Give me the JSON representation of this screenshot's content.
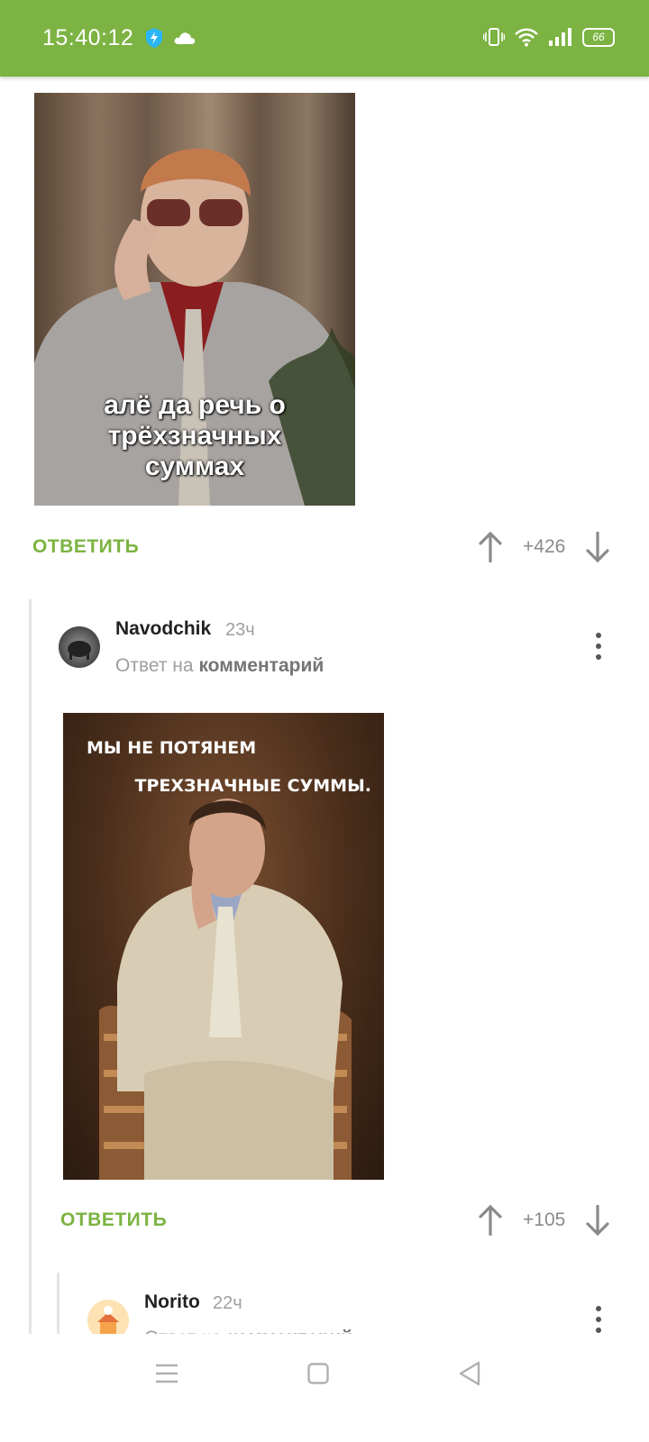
{
  "status_bar": {
    "time": "15:40:12",
    "battery": "66",
    "colors": {
      "background": "#7cb342"
    }
  },
  "comments": [
    {
      "image_caption": "алё да речь о трёхзначных суммах",
      "reply_label": "ОТВЕТИТЬ",
      "score": "+426"
    },
    {
      "username": "Navodchik",
      "time": "23ч",
      "reply_prefix": "Ответ на",
      "reply_target": "комментарий",
      "image_caption_line1": "МЫ НЕ ПОТЯНЕМ",
      "image_caption_line2": "ТРЕХЗНАЧНЫЕ СУММЫ.",
      "reply_label": "ОТВЕТИТЬ",
      "score": "+105"
    },
    {
      "username": "Norito",
      "time": "22ч",
      "reply_prefix": "Ответ на",
      "reply_target": "комментарий"
    }
  ],
  "nav": {
    "icons": [
      "menu-icon",
      "home-square-icon",
      "back-triangle-icon"
    ]
  }
}
